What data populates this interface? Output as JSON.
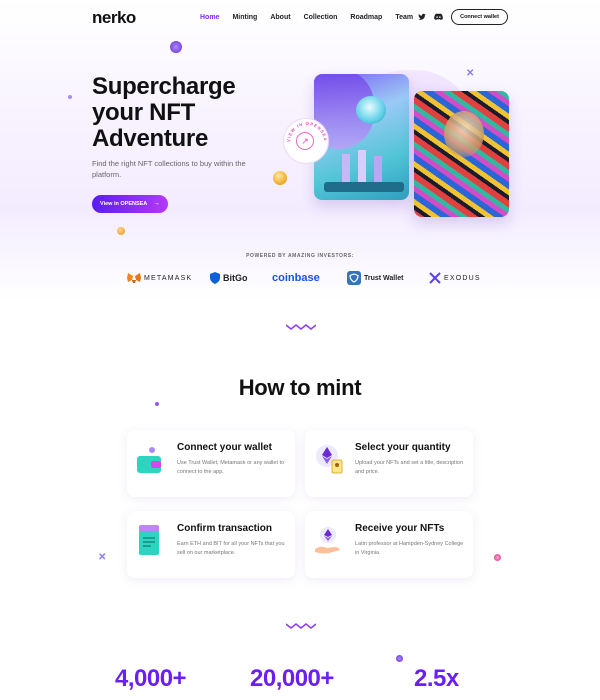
{
  "nav": {
    "logo": "nerko",
    "links": [
      "Home",
      "Minting",
      "About",
      "Collection",
      "Roadmap",
      "Team"
    ],
    "active": "Home",
    "connect_label": "Connect wallet",
    "social_icons": [
      "twitter-icon",
      "discord-icon"
    ]
  },
  "hero": {
    "title": "Supercharge your NFT Adventure",
    "subtitle": "Find the right NFT collections to buy within the platform.",
    "cta_label": "View in OPENSEA",
    "badge_text": "VIEW IN OPENSEA",
    "colors": {
      "accent": "#7a2ff7",
      "button_start": "#5a1df0",
      "button_end": "#b43af7"
    }
  },
  "investors": {
    "label": "POWERED BY AMAZING INVESTORS:",
    "items": [
      {
        "name": "METAMASK",
        "icon": "metamask-icon",
        "color": "#f6851b"
      },
      {
        "name": "BitGo",
        "icon": "bitgo-icon",
        "color": "#0a63d4"
      },
      {
        "name": "coinbase",
        "icon": "",
        "color": "#1652f0"
      },
      {
        "name": "Trust Wallet",
        "icon": "trust-wallet-icon",
        "color": "#3375bb"
      },
      {
        "name": "EXODUS",
        "icon": "exodus-icon",
        "color": "#5b3df5"
      }
    ]
  },
  "how_to_mint": {
    "title": "How to mint",
    "steps": [
      {
        "title": "Connect your wallet",
        "desc": "Use Trust Wallet, Metamask or any wallet to connect to the app.",
        "icon": "wallet-icon"
      },
      {
        "title": "Select your quantity",
        "desc": "Upload your NFTs and set a title, description and price.",
        "icon": "nft-quantity-icon"
      },
      {
        "title": "Confirm transaction",
        "desc": "Earn ETH and BIT for all your NFTs that you sell on our marketplace.",
        "icon": "document-icon"
      },
      {
        "title": "Receive your NFTs",
        "desc": "Latin professor at Hampden-Sydney College in Virginia.",
        "icon": "receive-icon"
      }
    ]
  },
  "stats": [
    "4,000+",
    "20,000+",
    "2.5x"
  ]
}
